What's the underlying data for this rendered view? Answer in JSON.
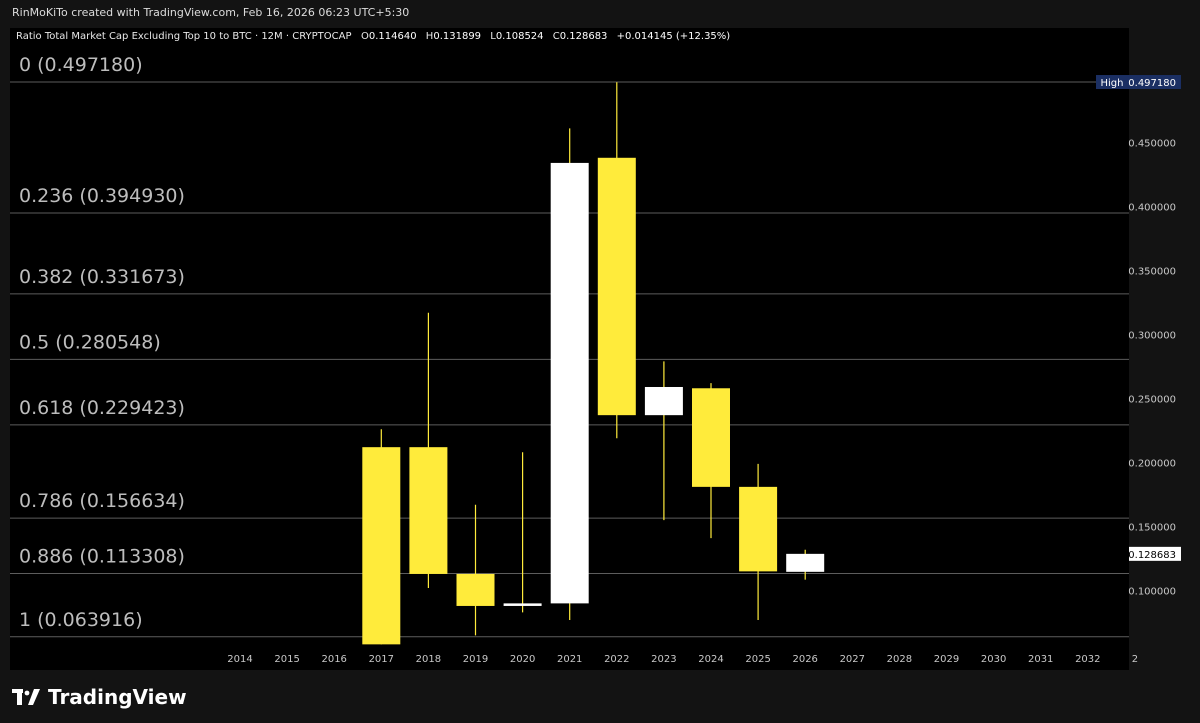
{
  "caption": "RinMoKiTo created with TradingView.com, Feb 16, 2026 06:23 UTC+5:30",
  "symbol": {
    "name": "Ratio Total Market Cap Excluding Top 10 to BTC · 12M · CRYPTOCAP",
    "o_label": "O",
    "o_value": "0.114640",
    "h_label": "H",
    "h_value": "0.131899",
    "l_label": "L",
    "l_value": "0.108524",
    "c_label": "C",
    "c_value": "0.128683",
    "change": "+0.014145 (+12.35%)"
  },
  "brand": "TradingView",
  "colors": {
    "background": "#000000",
    "up": "#ffffff",
    "down": "#ffeb3b",
    "fib_line": "#5d5d5d",
    "fib_text": "#bdbdbd",
    "axis_text": "#c8c8c8",
    "high_badge_bg": "#1b2f63",
    "wick": "#ffeb3b"
  },
  "chart_data": {
    "type": "candlestick",
    "ylim": [
      0.0575,
      0.505
    ],
    "x_categories": [
      "2014",
      "2015",
      "2016",
      "2017",
      "2018",
      "2019",
      "2020",
      "2021",
      "2022",
      "2023",
      "2024",
      "2025",
      "2026",
      "2027",
      "2028",
      "2029",
      "2030",
      "2031",
      "2032",
      "2"
    ],
    "y_ticks": [
      "0.450000",
      "0.400000",
      "0.350000",
      "0.300000",
      "0.250000",
      "0.200000",
      "0.150000",
      "0.100000"
    ],
    "candles": [
      {
        "year": "2017",
        "open": 0.212,
        "high": 0.226,
        "low": 0.058,
        "close": 0.058
      },
      {
        "year": "2018",
        "open": 0.212,
        "high": 0.317,
        "low": 0.102,
        "close": 0.113
      },
      {
        "year": "2019",
        "open": 0.113,
        "high": 0.167,
        "low": 0.065,
        "close": 0.088
      },
      {
        "year": "2020",
        "open": 0.088,
        "high": 0.208,
        "low": 0.083,
        "close": 0.09
      },
      {
        "year": "2021",
        "open": 0.09,
        "high": 0.461,
        "low": 0.077,
        "close": 0.434
      },
      {
        "year": "2022",
        "open": 0.438,
        "high": 0.497,
        "low": 0.219,
        "close": 0.237
      },
      {
        "year": "2023",
        "open": 0.237,
        "high": 0.279,
        "low": 0.155,
        "close": 0.259
      },
      {
        "year": "2024",
        "open": 0.258,
        "high": 0.262,
        "low": 0.141,
        "close": 0.181
      },
      {
        "year": "2025",
        "open": 0.181,
        "high": 0.199,
        "low": 0.077,
        "close": 0.115
      },
      {
        "year": "2026",
        "open": 0.11464,
        "high": 0.131899,
        "low": 0.108524,
        "close": 0.128683
      }
    ],
    "fib_levels": [
      {
        "label": "0 (0.497180)",
        "value": 0.49718
      },
      {
        "label": "0.236 (0.394930)",
        "value": 0.39493
      },
      {
        "label": "0.382 (0.331673)",
        "value": 0.331673
      },
      {
        "label": "0.5 (0.280548)",
        "value": 0.280548
      },
      {
        "label": "0.618 (0.229423)",
        "value": 0.229423
      },
      {
        "label": "0.786 (0.156634)",
        "value": 0.156634
      },
      {
        "label": "0.886 (0.113308)",
        "value": 0.113308
      },
      {
        "label": "1 (0.063916)",
        "value": 0.063916
      }
    ],
    "high_badge": {
      "label": "High",
      "value": "0.497180",
      "y": 0.49718
    },
    "last_price": {
      "value": "0.128683",
      "y": 0.128683
    }
  }
}
